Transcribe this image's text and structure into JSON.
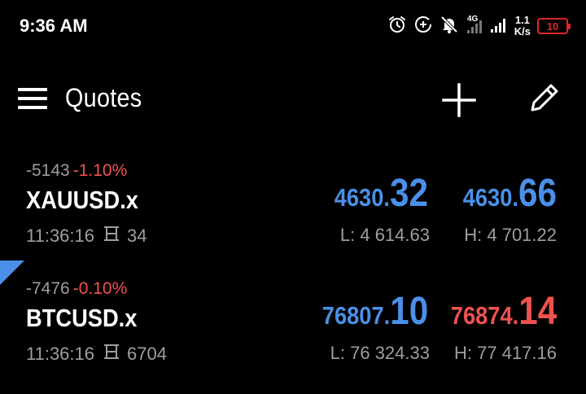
{
  "status_bar": {
    "time": "9:36 AM",
    "network_type": "4G",
    "net_speed_value": "1.1",
    "net_speed_unit": "K/s",
    "battery_level": "10",
    "icons": [
      "alarm-icon",
      "data-saver-icon",
      "mute-bell-icon",
      "signal-icon",
      "signal-icon",
      "battery-icon"
    ]
  },
  "toolbar": {
    "title": "Quotes",
    "menu_icon": "hamburger-menu-icon",
    "add_icon": "plus-icon",
    "edit_icon": "pencil-icon"
  },
  "quotes": [
    {
      "change_points": "-5143",
      "change_percent": "-1.10%",
      "symbol": "XAUUSD.x",
      "time": "11:36:16",
      "spread": "34",
      "bid_main": "4630.",
      "bid_big": "32",
      "bid_color": "blue",
      "ask_main": "4630.",
      "ask_big": "66",
      "ask_color": "blue",
      "low": "L: 4 614.63",
      "high": "H: 4 701.22"
    },
    {
      "change_points": "-7476",
      "change_percent": "-0.10%",
      "symbol": "BTCUSD.x",
      "time": "11:36:16",
      "spread": "6704",
      "bid_main": "76807.",
      "bid_big": "10",
      "bid_color": "blue",
      "ask_main": "76874.",
      "ask_big": "14",
      "ask_color": "red",
      "low": "L: 76 324.33",
      "high": "H: 77 417.16"
    }
  ],
  "colors": {
    "background": "#000000",
    "price_up": "#4a90e8",
    "price_down": "#ef5350",
    "muted_text": "#9e9e9e",
    "battery_low": "#e0262b"
  }
}
